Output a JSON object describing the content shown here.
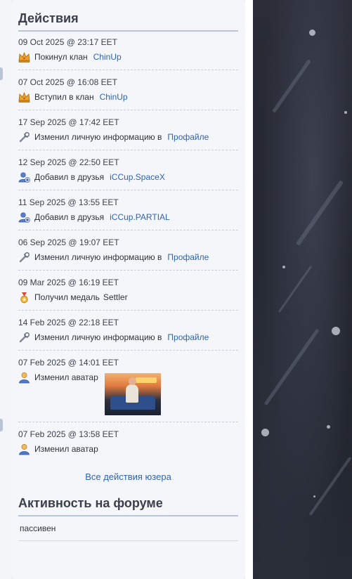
{
  "sections": {
    "actions_title": "Действия",
    "forum_title": "Активность на форуме"
  },
  "activities": [
    {
      "time": "09 Oct 2025 @ 23:17 EET",
      "icon": "crown-icon",
      "text": "Покинул клан",
      "target": "ChinUp",
      "target_type": "link"
    },
    {
      "time": "07 Oct 2025 @ 16:08 EET",
      "icon": "crown-icon",
      "text": "Вступил в клан",
      "target": "ChinUp",
      "target_type": "link"
    },
    {
      "time": "17 Sep 2025 @ 17:42 EET",
      "icon": "wrench-icon",
      "text": "Изменил личную информацию в",
      "target": "Профайле",
      "target_type": "link"
    },
    {
      "time": "12 Sep 2025 @ 22:50 EET",
      "icon": "add-friend-icon",
      "text": "Добавил в друзья",
      "target": "iCCup.SpaceX",
      "target_type": "link"
    },
    {
      "time": "11 Sep 2025 @ 13:55 EET",
      "icon": "add-friend-icon",
      "text": "Добавил в друзья",
      "target": "iCCup.PARTIAL",
      "target_type": "link"
    },
    {
      "time": "06 Sep 2025 @ 19:07 EET",
      "icon": "wrench-icon",
      "text": "Изменил личную информацию в",
      "target": "Профайле",
      "target_type": "link"
    },
    {
      "time": "09 Mar 2025 @ 16:19 EET",
      "icon": "medal-icon",
      "text": "Получил медаль",
      "target": "Settler",
      "target_type": "plain"
    },
    {
      "time": "14 Feb 2025 @ 22:18 EET",
      "icon": "wrench-icon",
      "text": "Изменил личную информацию в",
      "target": "Профайле",
      "target_type": "link"
    },
    {
      "time": "07 Feb 2025 @ 14:01 EET",
      "icon": "user-icon",
      "text": "Изменил аватар",
      "target": "",
      "target_type": "avatar"
    },
    {
      "time": "07 Feb 2025 @ 13:58 EET",
      "icon": "user-icon",
      "text": "Изменил аватар",
      "target": "",
      "target_type": "none"
    }
  ],
  "all_actions_link": "Все действия юзера",
  "forum_status": "пассивен",
  "colors": {
    "link": "#2e64b4",
    "divider": "#b7c4da",
    "panel_bg": "#f4f6f9",
    "background_art": "#262a34"
  }
}
